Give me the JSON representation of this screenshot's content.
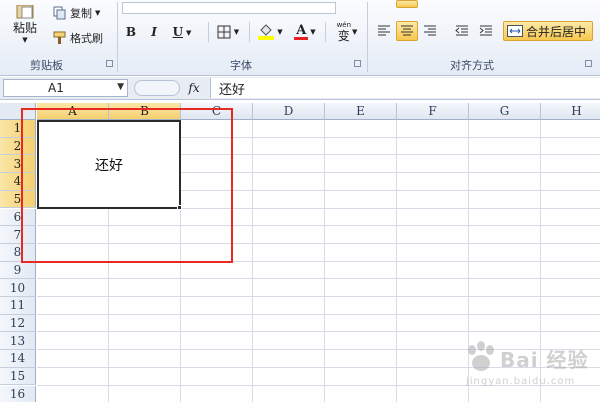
{
  "ribbon": {
    "clipboard": {
      "paste_label": "粘贴",
      "copy_label": "复制",
      "format_painter_label": "格式刷",
      "group_label": "剪贴板"
    },
    "font": {
      "bold_label": "B",
      "italic_label": "I",
      "underline_label": "U",
      "font_color_glyph": "A",
      "phonetic_glyph": "wén",
      "phonetic_char": "变",
      "group_label": "字体"
    },
    "alignment": {
      "merge_label": "合并后居中",
      "group_label": "对齐方式"
    }
  },
  "formula_bar": {
    "name_box": "A1",
    "fx_label": "fx",
    "formula": "还好"
  },
  "grid": {
    "columns": [
      "A",
      "B",
      "C",
      "D",
      "E",
      "F",
      "G",
      "H"
    ],
    "rows": [
      "1",
      "2",
      "3",
      "4",
      "5",
      "6",
      "7",
      "8",
      "9",
      "10",
      "11",
      "12",
      "13",
      "14",
      "15",
      "16"
    ],
    "selected_columns": [
      "A",
      "B"
    ],
    "selected_rows": [
      "1",
      "2",
      "3",
      "4",
      "5"
    ],
    "merged_cell_text": "还好"
  },
  "watermark": {
    "text": "Bai 经验",
    "url": "jingyan.baidu.com"
  },
  "colors": {
    "annotation_border": "#e62a22",
    "selection_header": "#f5cf6f",
    "active_button": "#f7c84e"
  }
}
